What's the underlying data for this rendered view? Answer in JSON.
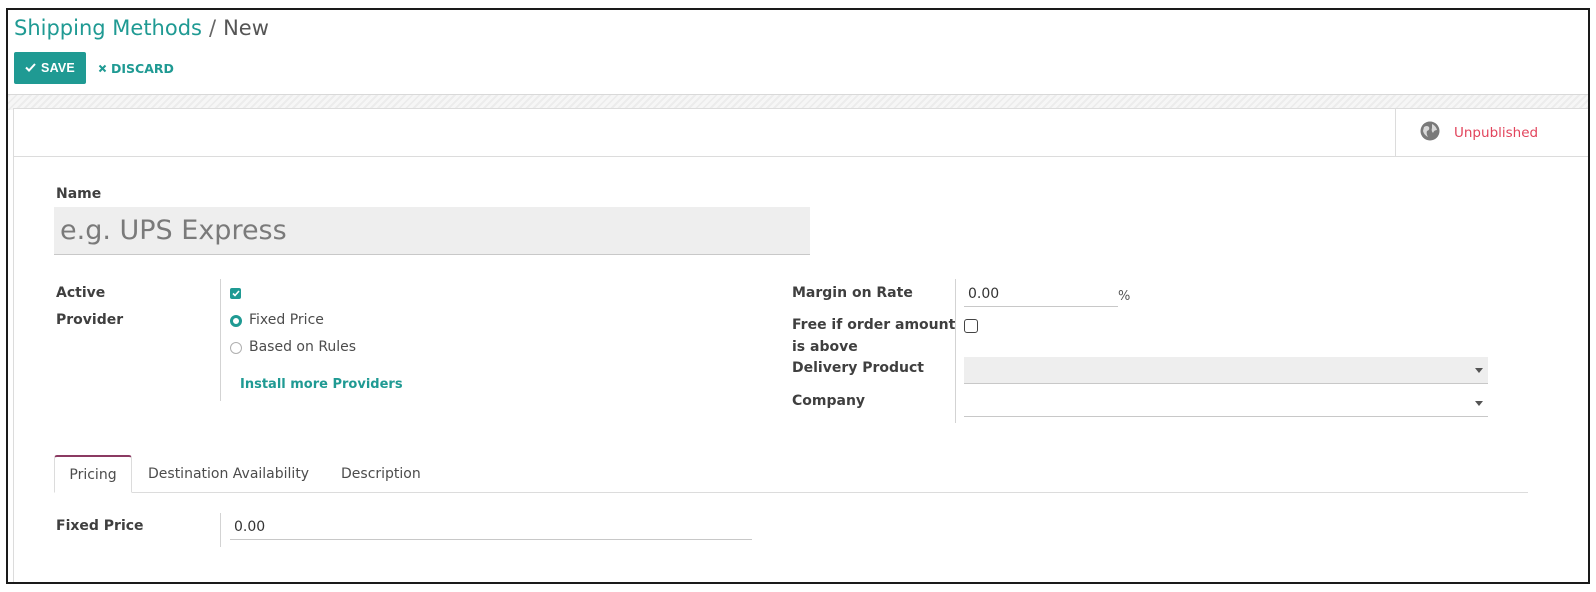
{
  "breadcrumb": {
    "parent": "Shipping Methods",
    "separator": "/",
    "current": "New"
  },
  "toolbar": {
    "save_label": "SAVE",
    "discard_label": "DISCARD"
  },
  "header": {
    "publish_status": "Unpublished"
  },
  "form": {
    "name_label": "Name",
    "name_placeholder": "e.g. UPS Express",
    "active_label": "Active",
    "active_checked": true,
    "provider_label": "Provider",
    "provider_options": [
      "Fixed Price",
      "Based on Rules"
    ],
    "provider_selected": "Fixed Price",
    "install_link": "Install more Providers",
    "margin_label": "Margin on Rate",
    "margin_value": "0.00",
    "margin_unit": "%",
    "free_label_line1": "Free if order amount",
    "free_label_line2": "is above",
    "free_checked": false,
    "delivery_product_label": "Delivery Product",
    "delivery_product_value": "",
    "company_label": "Company",
    "company_value": ""
  },
  "tabs": [
    {
      "label": "Pricing",
      "active": true
    },
    {
      "label": "Destination Availability",
      "active": false
    },
    {
      "label": "Description",
      "active": false
    }
  ],
  "pricing": {
    "fixed_price_label": "Fixed Price",
    "fixed_price_value": "0.00"
  },
  "colors": {
    "accent": "#1f9a93",
    "unpublished": "#e2445c",
    "active_tab": "#8b3a62"
  },
  "icons": {
    "save": "check-icon",
    "discard": "close-icon",
    "publish": "globe-icon"
  }
}
